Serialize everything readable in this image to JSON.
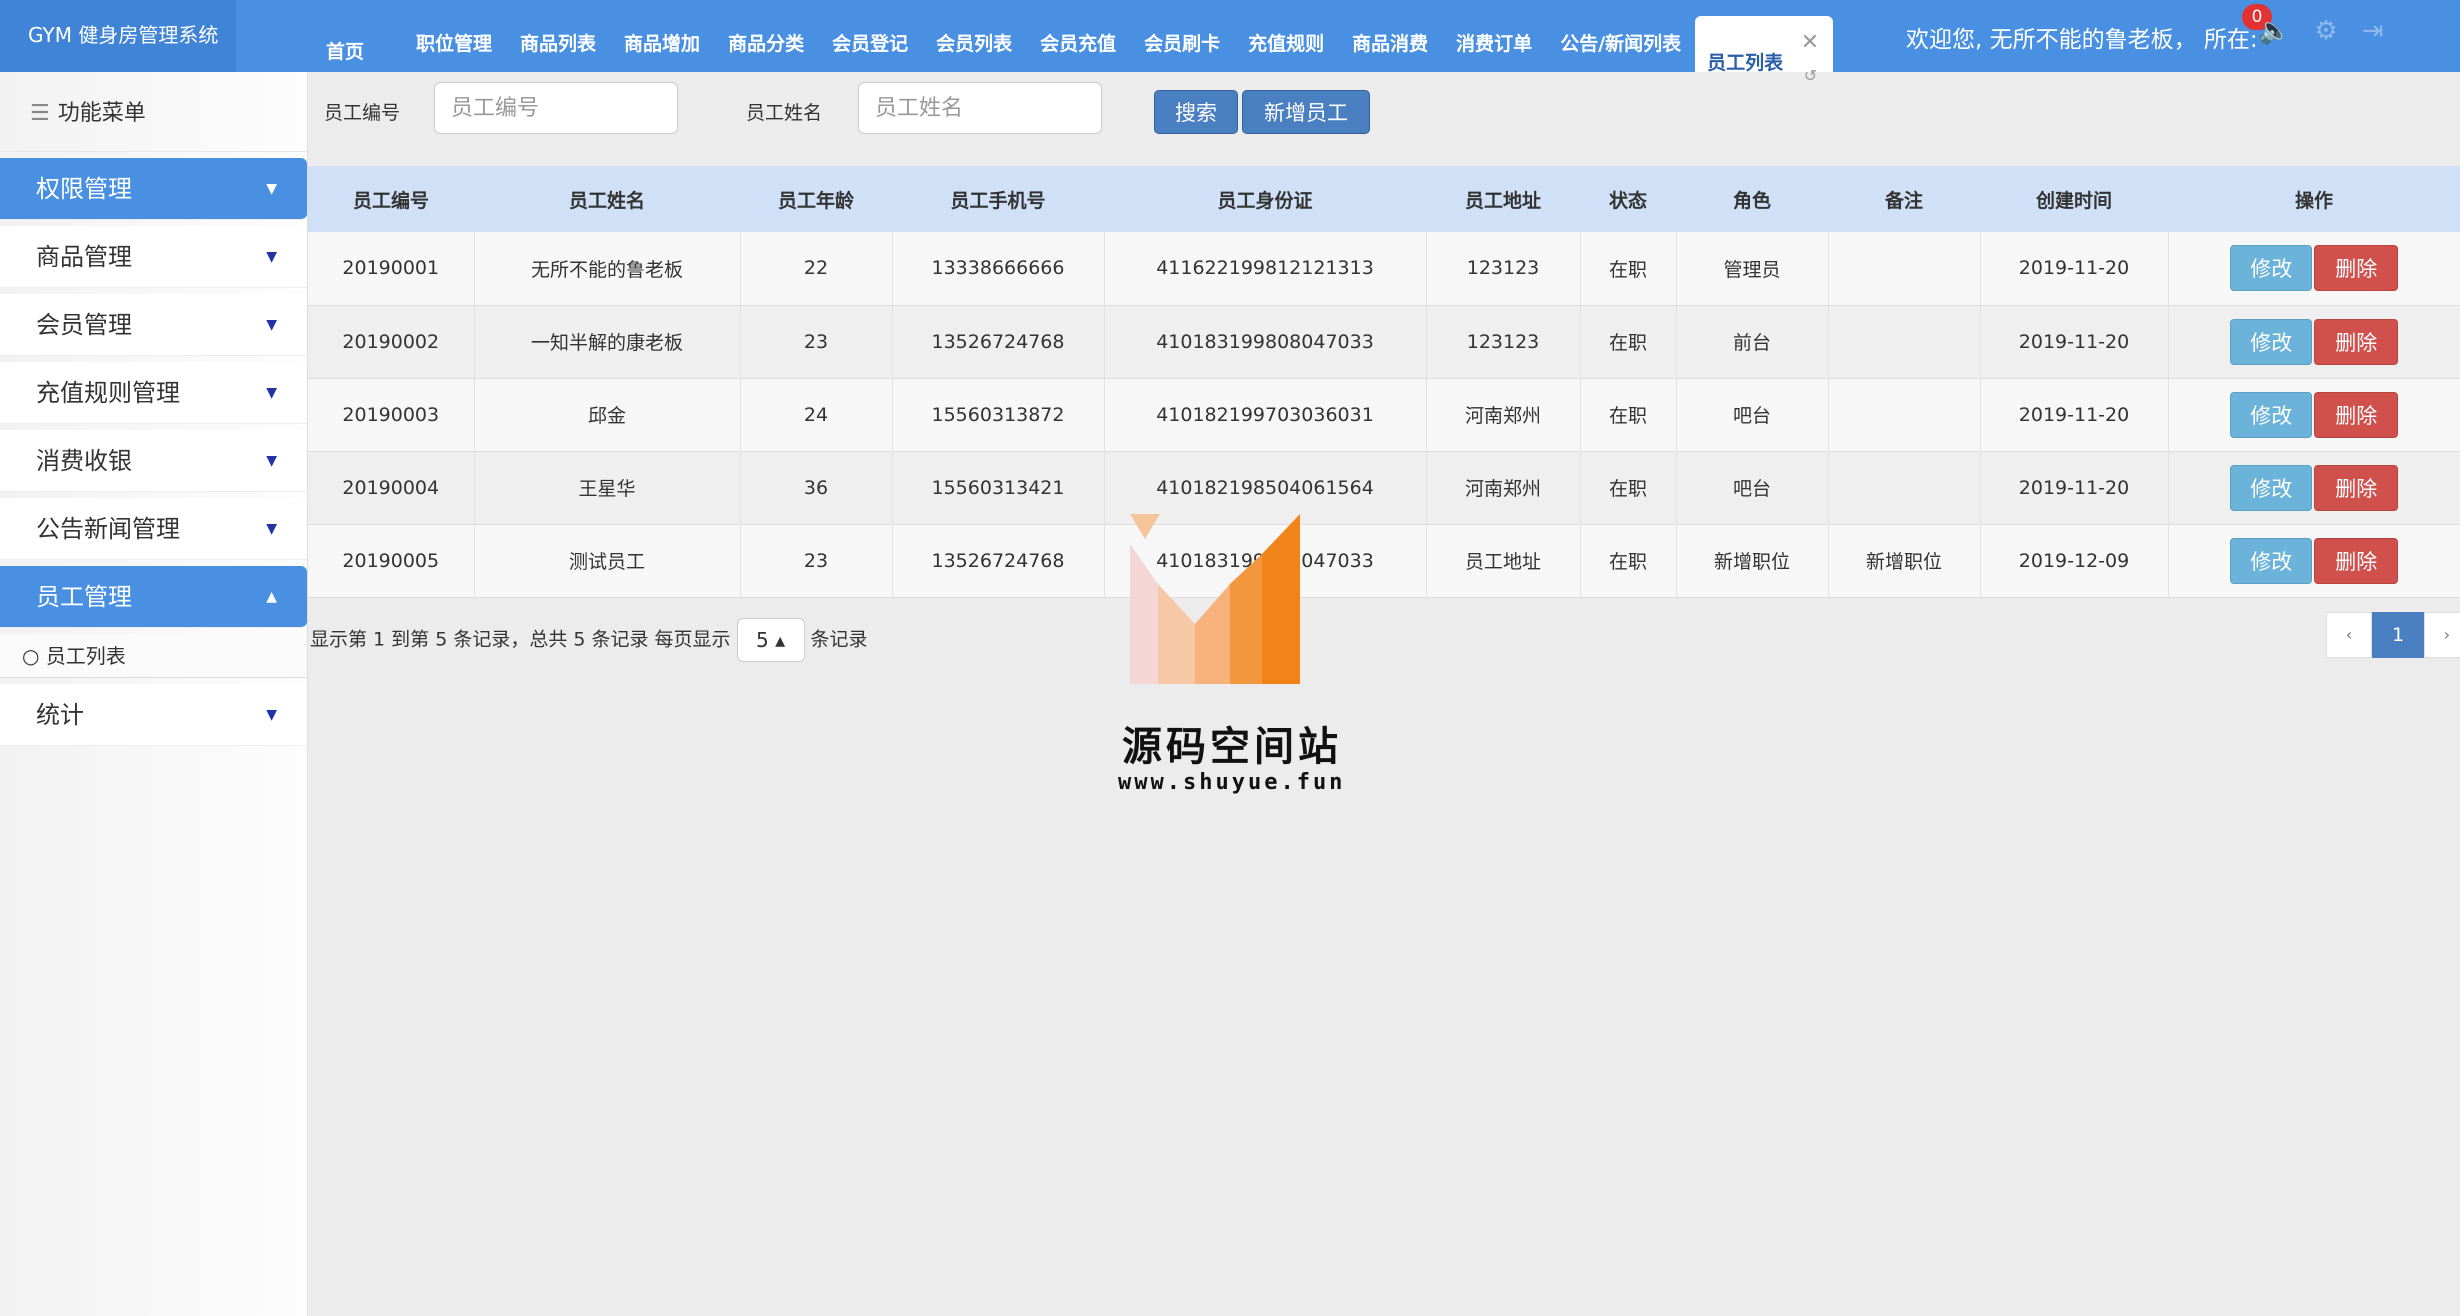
{
  "app": {
    "logo": "GYM 健身房管理系统"
  },
  "header": {
    "tabs": [
      "首页",
      "职位管理",
      "商品列表",
      "商品增加",
      "商品分类",
      "会员登记",
      "会员列表",
      "会员充值",
      "会员刷卡",
      "充值规则",
      "商品消费",
      "消费订单",
      "公告/新闻列表"
    ],
    "active_tab": "员工列表",
    "welcome": "欢迎您, 无所不能的鲁老板， 所在:",
    "notification_count": "0"
  },
  "sidebar": {
    "title": "功能菜单",
    "items": [
      "权限管理",
      "商品管理",
      "会员管理",
      "充值规则管理",
      "消费收银",
      "公告新闻管理",
      "员工管理",
      "统计"
    ],
    "submenu_item": "员工列表"
  },
  "search": {
    "id_label": "员工编号",
    "id_placeholder": "员工编号",
    "name_label": "员工姓名",
    "name_placeholder": "员工姓名",
    "search_button": "搜索",
    "add_button": "新增员工"
  },
  "table": {
    "headers": [
      "员工编号",
      "员工姓名",
      "员工年龄",
      "员工手机号",
      "员工身份证",
      "员工地址",
      "状态",
      "角色",
      "备注",
      "创建时间",
      "操作"
    ],
    "rows": [
      [
        "20190001",
        "无所不能的鲁老板",
        "22",
        "13338666666",
        "411622199812121313",
        "123123",
        "在职",
        "管理员",
        "",
        "2019-11-20"
      ],
      [
        "20190002",
        "一知半解的康老板",
        "23",
        "13526724768",
        "410183199808047033",
        "123123",
        "在职",
        "前台",
        "",
        "2019-11-20"
      ],
      [
        "20190003",
        "邱金",
        "24",
        "15560313872",
        "410182199703036031",
        "河南郑州",
        "在职",
        "吧台",
        "",
        "2019-11-20"
      ],
      [
        "20190004",
        "王星华",
        "36",
        "15560313421",
        "410182198504061564",
        "河南郑州",
        "在职",
        "吧台",
        "",
        "2019-11-20"
      ],
      [
        "20190005",
        "测试员工",
        "23",
        "13526724768",
        "410183199808047033",
        "员工地址",
        "在职",
        "新增职位",
        "新增职位",
        "2019-12-09"
      ]
    ],
    "edit_label": "修改",
    "delete_label": "删除"
  },
  "pagination": {
    "info_prefix": "显示第 1 到第 5 条记录，总共 5 条记录  每页显示",
    "page_size": "5 ▴",
    "info_suffix": "条记录",
    "prev": "‹",
    "current": "1",
    "next": "›"
  },
  "watermark": {
    "title": "源码空间站",
    "url": "www.shuyue.fun"
  }
}
